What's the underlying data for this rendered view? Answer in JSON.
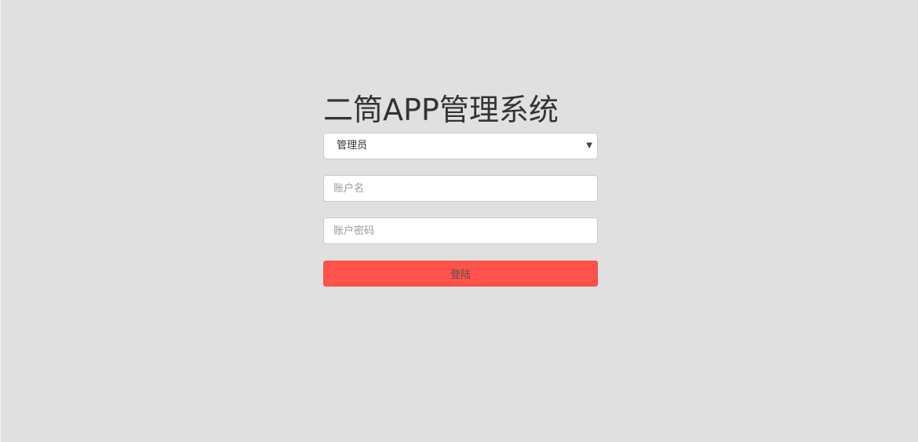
{
  "app": {
    "title": "二筒APP管理系统"
  },
  "login": {
    "role_select": {
      "selected": "管理员",
      "arrow_icon": "caret-down-icon"
    },
    "username": {
      "value": "",
      "placeholder": "账户名"
    },
    "password": {
      "value": "",
      "placeholder": "账户密码"
    },
    "submit_label": "登陆"
  },
  "colors": {
    "background": "#e0e0e0",
    "button": "#ff524a",
    "title_text": "#333333"
  }
}
